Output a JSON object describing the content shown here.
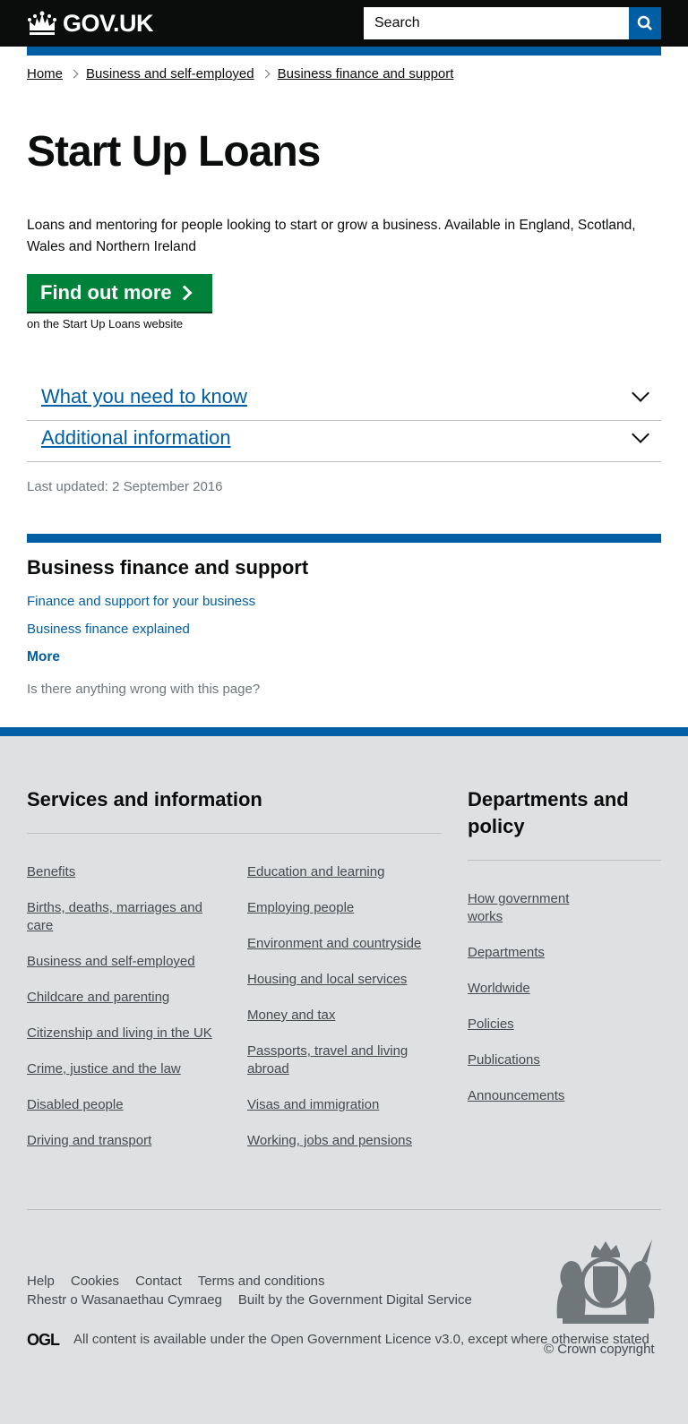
{
  "header": {
    "logo_text": "GOV.UK",
    "search_placeholder": "Search",
    "search_button_label": "Search"
  },
  "breadcrumbs": [
    {
      "label": "Home"
    },
    {
      "label": "Business and self-employed"
    },
    {
      "label": "Business finance and support"
    }
  ],
  "main": {
    "title": "Start Up Loans",
    "intro": "Loans and mentoring for people looking to start or grow a business. Available in England, Scotland, Wales and Northern Ireland",
    "start_button": "Find out more",
    "start_note": "on the Start Up Loans website",
    "accordion": [
      {
        "label": "What you need to know"
      },
      {
        "label": "Additional information"
      }
    ],
    "last_updated": "Last updated: 2 September 2016"
  },
  "related": {
    "heading": "Business finance and support",
    "links": [
      {
        "label": "Finance and support for your business"
      },
      {
        "label": "Business finance explained"
      }
    ],
    "more_label": "More"
  },
  "report_link": "Is there anything wrong with this page?",
  "footer": {
    "services_heading": "Services and information",
    "services_col1": [
      "Benefits",
      "Births, deaths, marriages and care",
      "Business and self-employed",
      "Childcare and parenting",
      "Citizenship and living in the UK",
      "Crime, justice and the law",
      "Disabled people",
      "Driving and transport"
    ],
    "services_col2": [
      "Education and learning",
      "Employing people",
      "Environment and countryside",
      "Housing and local services",
      "Money and tax",
      "Passports, travel and living abroad",
      "Visas and immigration",
      "Working, jobs and pensions"
    ],
    "departments_heading": "Departments and policy",
    "departments": [
      "How government works",
      "Departments",
      "Worldwide",
      "Policies",
      "Publications",
      "Announcements"
    ],
    "meta_links": [
      "Help",
      "Cookies",
      "Contact",
      "Terms and conditions"
    ],
    "welsh_link": "Rhestr o Wasanaethau Cymraeg",
    "built_by_prefix": "Built by the",
    "built_by_link": "Government Digital Service",
    "ogl_logo": "OGL",
    "licence_prefix": "All content is available under the",
    "licence_link": "Open Government Licence v3.0",
    "licence_suffix": ", except where otherwise stated",
    "copyright": "© Crown copyright"
  },
  "colors": {
    "header_bg": "#0b0c0c",
    "link_blue": "#005ea5",
    "start_button_green": "#00823b",
    "footer_bg": "#dee0e2"
  }
}
